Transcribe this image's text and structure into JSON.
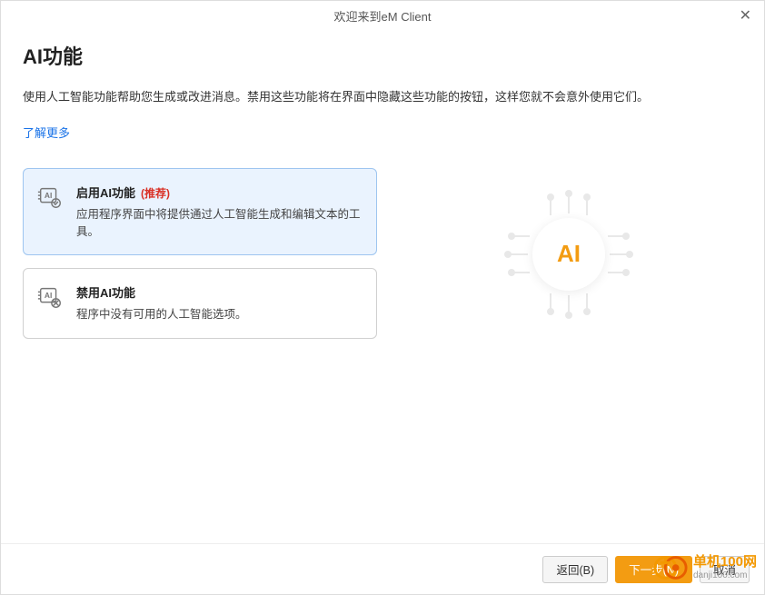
{
  "titlebar": {
    "title": "欢迎来到eM Client"
  },
  "page": {
    "heading": "AI功能",
    "description": "使用人工智能功能帮助您生成或改进消息。禁用这些功能将在界面中隐藏这些功能的按钮，这样您就不会意外使用它们。",
    "learn_more": "了解更多"
  },
  "options": {
    "enable": {
      "title": "启用AI功能",
      "badge": "(推荐)",
      "desc": "应用程序界面中将提供通过人工智能生成和编辑文本的工具。"
    },
    "disable": {
      "title": "禁用AI功能",
      "desc": "程序中没有可用的人工智能选项。"
    }
  },
  "illustration": {
    "label": "AI"
  },
  "footer": {
    "back": "返回(B)",
    "next": "下一步(N)",
    "cancel": "取消"
  },
  "watermark": {
    "brand": "单机100网",
    "url": "danji100.com"
  }
}
